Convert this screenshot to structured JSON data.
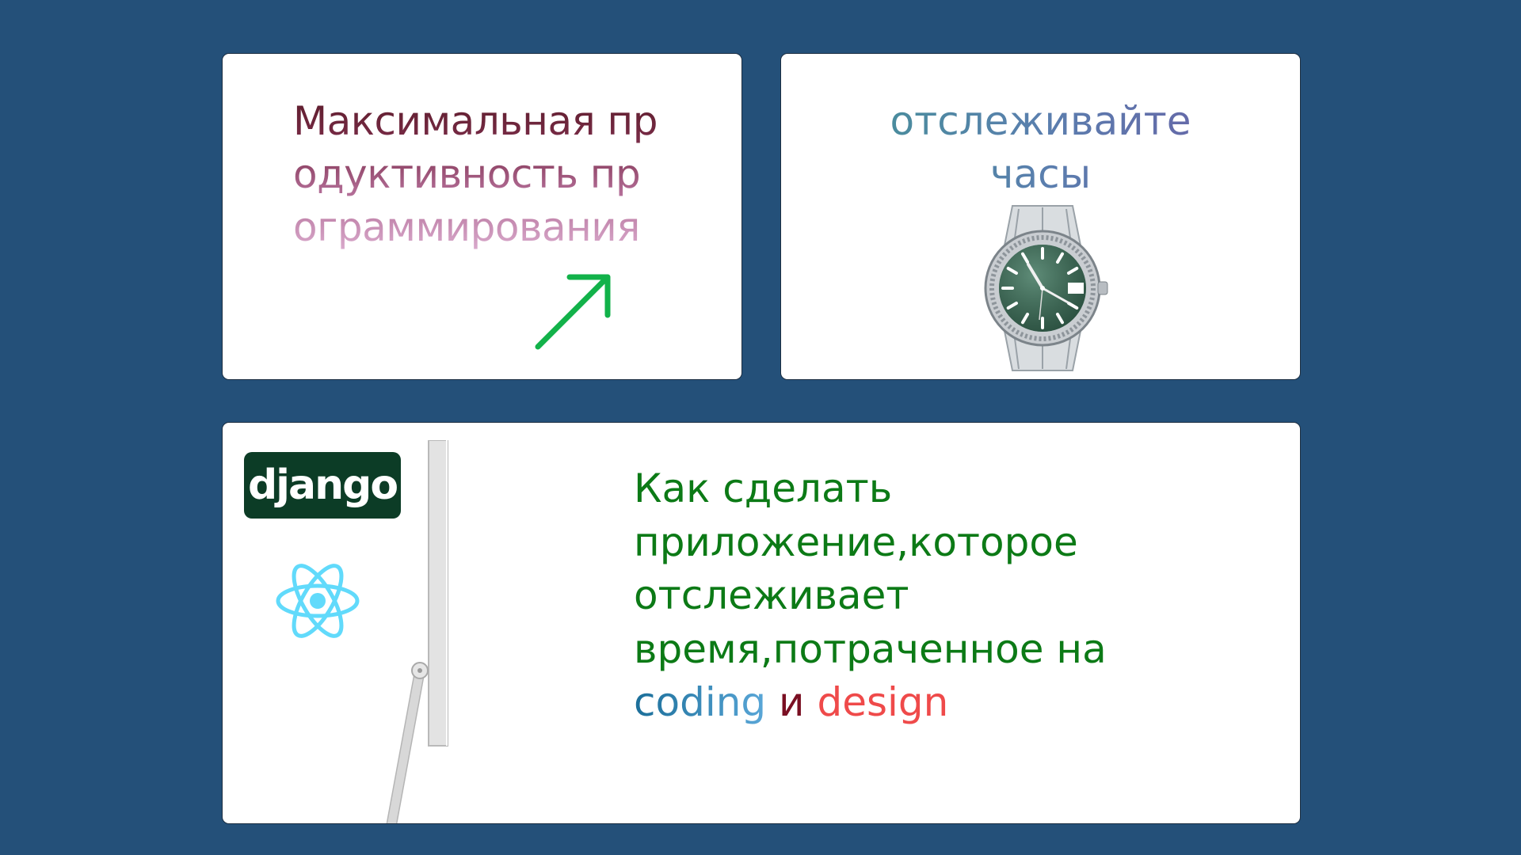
{
  "cards": {
    "productivity": {
      "title": "Максимальная продуктивность программирования"
    },
    "watch": {
      "title_line1": "отслеживайте",
      "title_line2": "часы"
    },
    "app": {
      "django_logo": "django",
      "line1": "Как сделать",
      "line2": "приложение,которое",
      "line3": "отслеживает",
      "line4": "время,потраченное на",
      "word_coding": "coding",
      "word_and": "и",
      "word_design": "design"
    }
  },
  "colors": {
    "background": "#245079",
    "card": "#ffffff",
    "arrow": "#12b24a",
    "react": "#61dafb",
    "django": "#0c3c26",
    "app_text": "#0c7a16",
    "design": "#ef4a4a"
  },
  "icons": [
    "trend-arrow-icon",
    "wristwatch-image",
    "django-logo",
    "react-logo-icon",
    "monitor-stand-image"
  ]
}
